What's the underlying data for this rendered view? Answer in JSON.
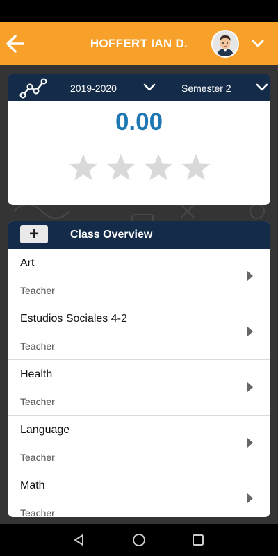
{
  "header": {
    "user_name": "HOFFERT IAN D.",
    "icons": [
      "back-arrow-icon",
      "avatar",
      "chevron-down-icon"
    ],
    "accent_color": "#f7a12a"
  },
  "gpa": {
    "year": "2019-2020",
    "semester": "Semester 2",
    "value": "0.00",
    "value_color": "#1f78b4",
    "stars_total": 4,
    "stars_filled": 0,
    "bar_color": "#142c4a"
  },
  "classes": {
    "title": "Class Overview",
    "add_label": "+",
    "items": [
      {
        "name": "Art",
        "role": "Teacher"
      },
      {
        "name": "Estudios Sociales 4-2",
        "role": "Teacher"
      },
      {
        "name": "Health",
        "role": "Teacher"
      },
      {
        "name": "Language",
        "role": "Teacher"
      },
      {
        "name": "Math",
        "role": "Teacher"
      }
    ]
  },
  "nav": {
    "icons": [
      "back-triangle-icon",
      "home-circle-icon",
      "recents-square-icon"
    ]
  }
}
